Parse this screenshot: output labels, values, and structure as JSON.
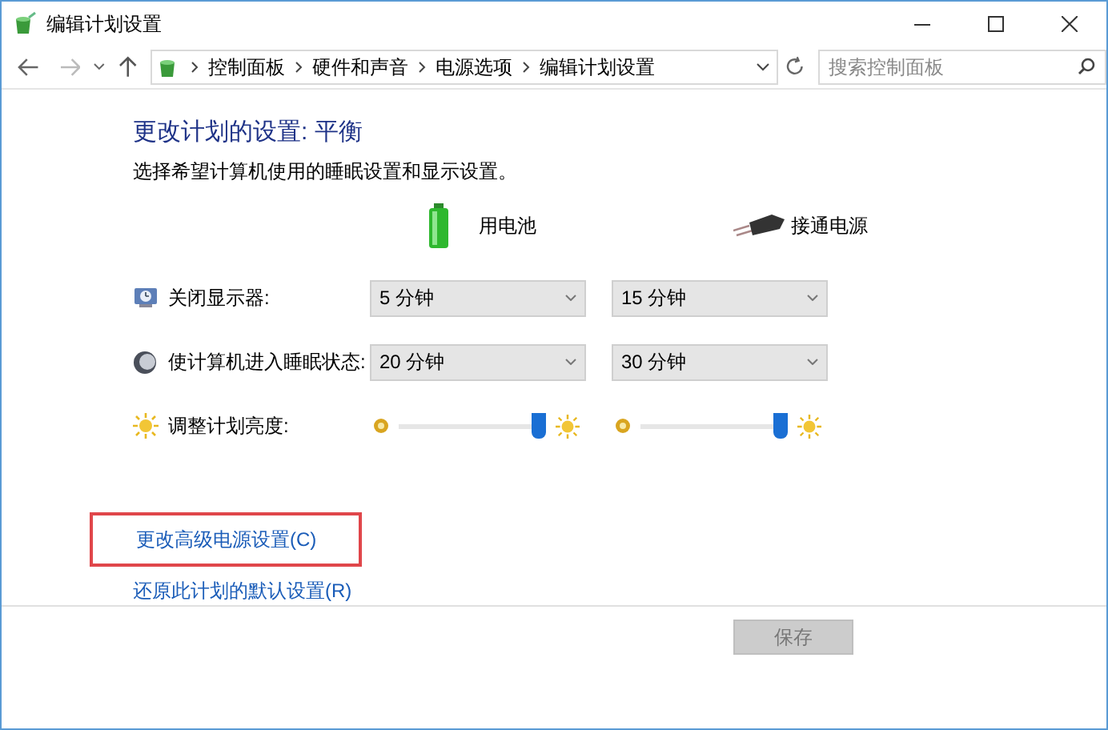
{
  "window": {
    "title": "编辑计划设置"
  },
  "address_bar": {
    "breadcrumbs": [
      "控制面板",
      "硬件和声音",
      "电源选项",
      "编辑计划设置"
    ]
  },
  "search": {
    "placeholder": "搜索控制面板"
  },
  "heading": "更改计划的设置: 平衡",
  "subheading": "选择希望计算机使用的睡眠设置和显示设置。",
  "columns": [
    "用电池",
    "接通电源"
  ],
  "settings": [
    {
      "kind": "dropdown",
      "label": "关闭显示器:",
      "values": [
        "5 分钟",
        "15 分钟"
      ]
    },
    {
      "kind": "dropdown",
      "label": "使计算机进入睡眠状态:",
      "values": [
        "20 分钟",
        "30 分钟"
      ]
    },
    {
      "kind": "slider",
      "label": "调整计划亮度:",
      "levels": [
        {
          "level": 1.0
        },
        {
          "level": 1.0
        }
      ]
    }
  ],
  "links": [
    {
      "label": "更改高级电源设置(C)",
      "highlighted": true
    },
    {
      "label": "还原此计划的默认设置(R)",
      "highlighted": false
    }
  ],
  "buttons": [
    {
      "label": "保存",
      "disabled": true
    }
  ]
}
